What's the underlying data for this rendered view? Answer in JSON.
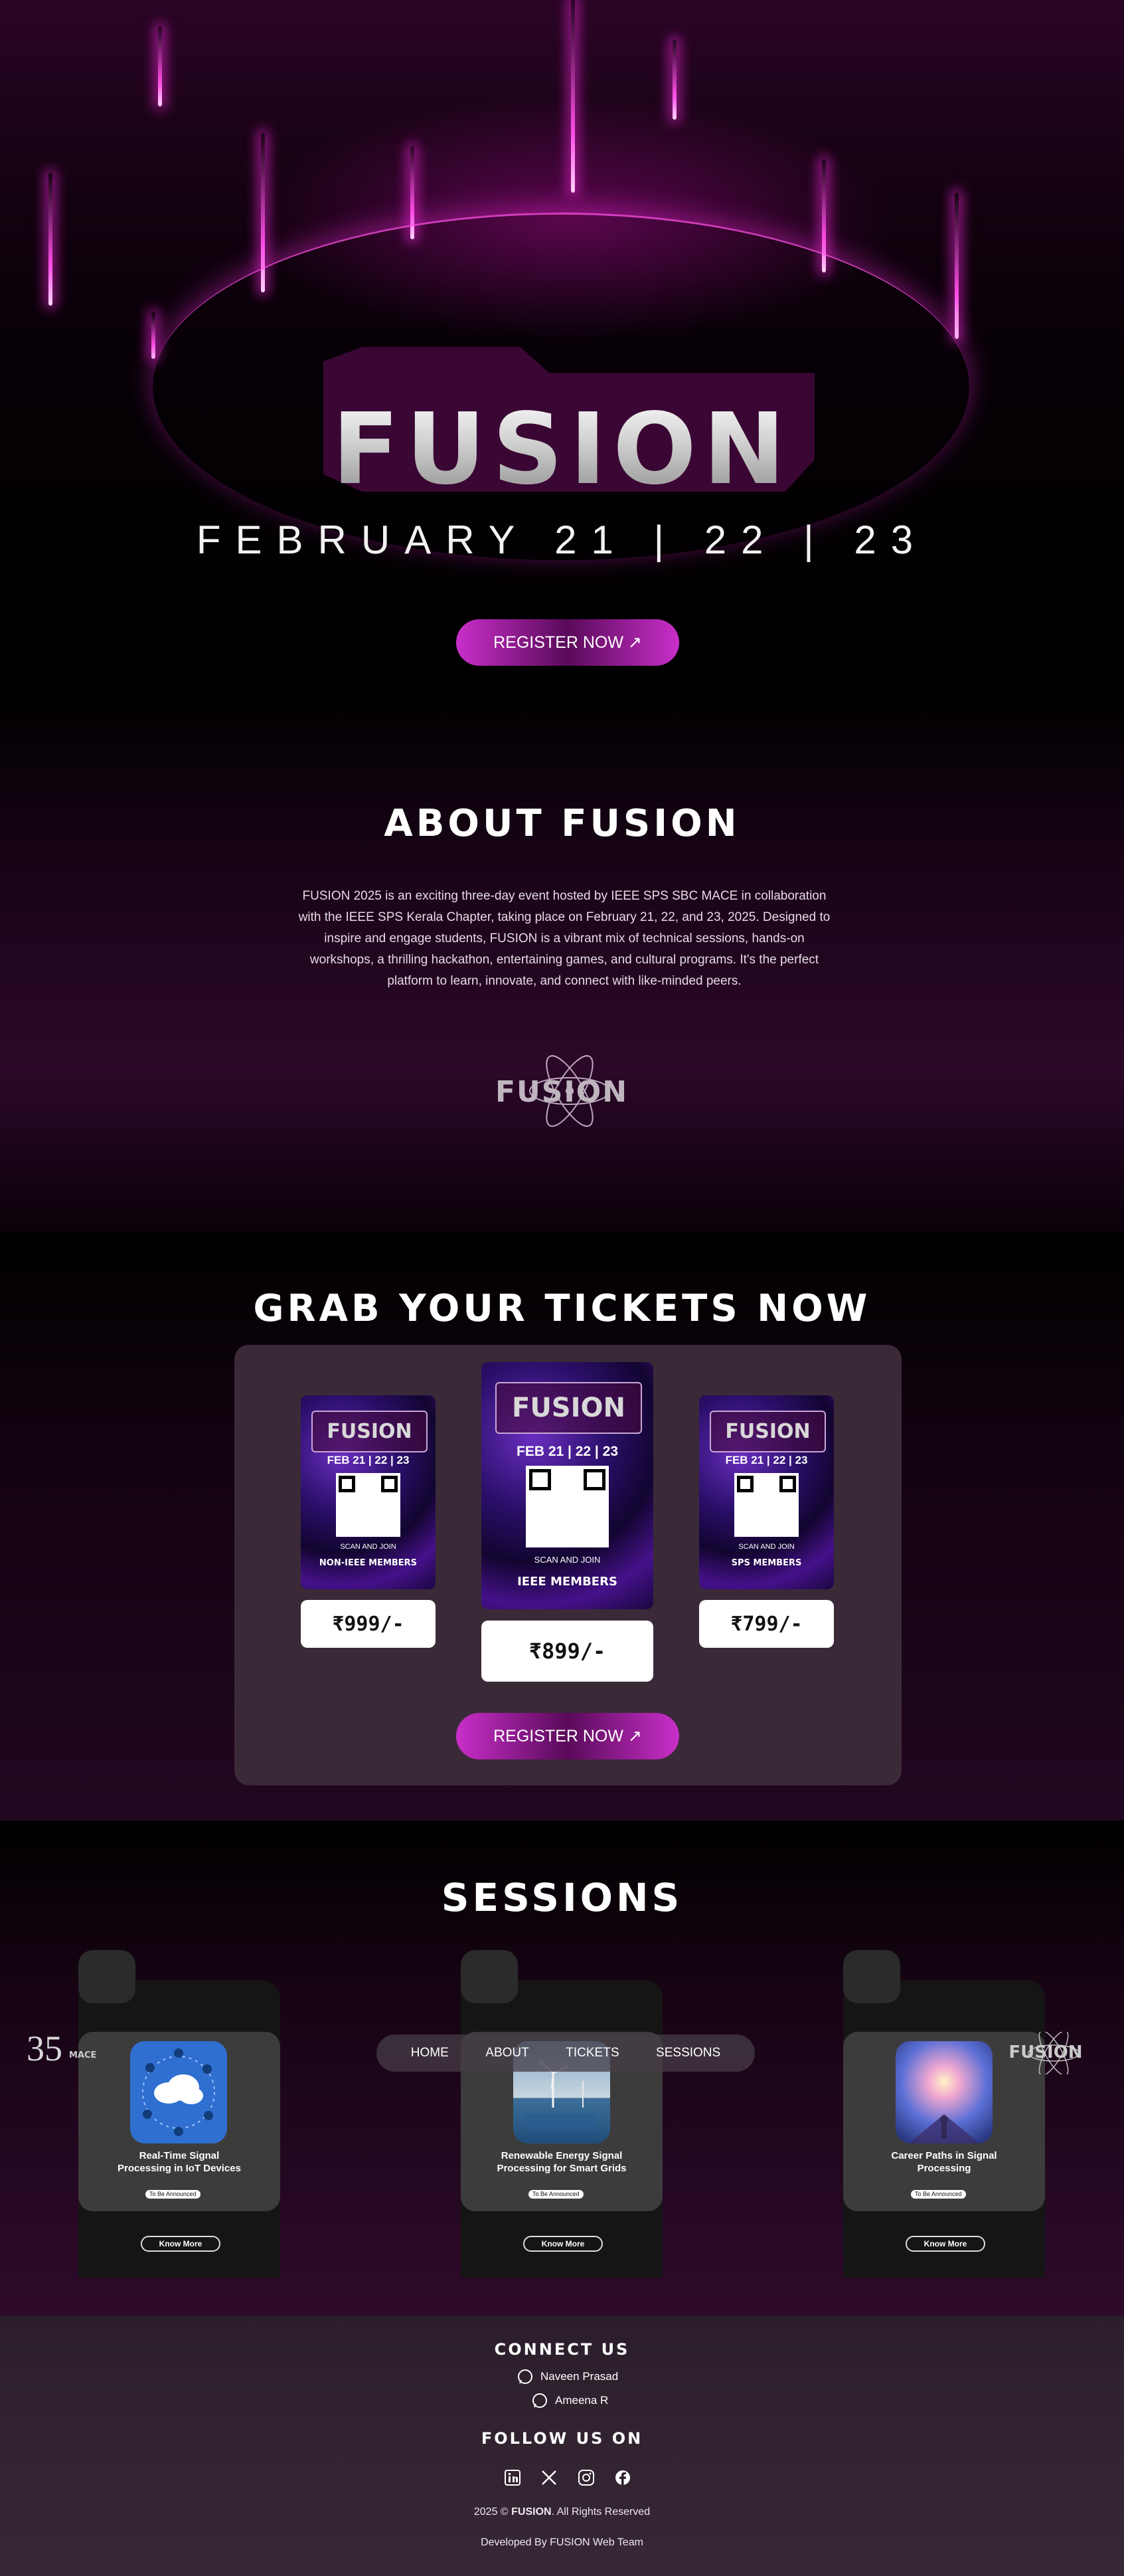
{
  "hero": {
    "logo": "FUSION",
    "dates": "FEBRUARY 21 | 22 | 23",
    "register_label": "REGISTER NOW ↗"
  },
  "about": {
    "title": "ABOUT FUSION",
    "lines": [
      "FUSION 2025 is an exciting three-day event hosted by IEEE SPS SBC MACE in collaboration",
      "with the IEEE SPS Kerala Chapter, taking place on February 21, 22, and 23, 2025. Designed to",
      "inspire and engage students, FUSION is a vibrant mix of technical sessions, hands-on",
      "workshops, a thrilling hackathon, entertaining games, and cultural programs. It's the perfect",
      "platform to learn, innovate, and connect with like-minded peers."
    ],
    "emblem_text": "FUSION"
  },
  "tickets": {
    "title": "GRAB YOUR TICKETS NOW",
    "register_label": "REGISTER NOW ↗",
    "cards": [
      {
        "logo": "FUSION",
        "date": "FEB 21 | 22 | 23",
        "scan": "SCAN AND JOIN",
        "type": "NON-IEEE MEMBERS",
        "price": "₹999/-"
      },
      {
        "logo": "FUSION",
        "date": "FEB 21 | 22 | 23",
        "scan": "SCAN AND JOIN",
        "type": "IEEE MEMBERS",
        "price": "₹899/-"
      },
      {
        "logo": "FUSION",
        "date": "FEB 21 | 22 | 23",
        "scan": "SCAN AND JOIN",
        "type": "SPS MEMBERS",
        "price": "₹799/-"
      }
    ]
  },
  "sessions": {
    "title": "SESSIONS",
    "items": [
      {
        "title": "Real-Time Signal Processing in IoT Devices",
        "badge": "To Be Announced",
        "button": "Know More",
        "icon": "cloud-network-image"
      },
      {
        "title": "Renewable Energy Signal Processing for Smart Grids",
        "badge": "To Be Announced",
        "button": "Know More",
        "icon": "wind-turbine-image"
      },
      {
        "title": "Career Paths in Signal Processing",
        "badge": "To Be Announced",
        "button": "Know More",
        "icon": "galaxy-person-image"
      }
    ]
  },
  "nav": {
    "items": [
      "HOME",
      "ABOUT",
      "TICKETS",
      "SESSIONS"
    ],
    "left_logo_number": "35",
    "left_logo_text": "MACE",
    "right_logo_text": "FUSION"
  },
  "footer": {
    "connect_title": "CONNECT US",
    "contacts": [
      "Naveen Prasad",
      "Ameena R"
    ],
    "follow_title": "FOLLOW US ON",
    "socials": [
      "linkedin-icon",
      "x-icon",
      "instagram-icon",
      "facebook-icon"
    ],
    "copyright_pre": "2025 © ",
    "copyright_brand": "FUSION",
    "copyright_post": ". All Rights Reserved",
    "developed": "Developed By FUSION Web Team"
  },
  "colors": {
    "accent": "#c92fc9",
    "beam": "#ff4fe8",
    "panel": "#3a2a38",
    "footer": "#2b1e2a"
  }
}
